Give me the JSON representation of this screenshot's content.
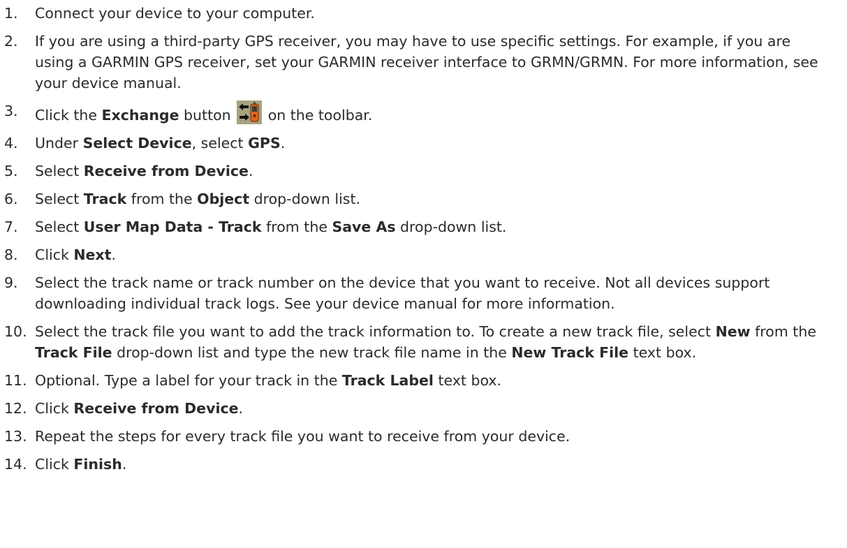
{
  "steps": [
    {
      "num": "1.",
      "parts": [
        {
          "t": "Connect your device to your computer."
        }
      ]
    },
    {
      "num": "2.",
      "parts": [
        {
          "t": "If you are using a third-party GPS receiver, you may have to use specific settings. For example, if you are using a GARMIN GPS receiver, set your GARMIN receiver interface to GRMN/GRMN. For more information, see your device manual."
        }
      ]
    },
    {
      "num": "3.",
      "parts": [
        {
          "t": "Click the "
        },
        {
          "t": "Exchange",
          "b": true
        },
        {
          "t": " button "
        },
        {
          "icon": "exchange-icon"
        },
        {
          "t": " on the toolbar."
        }
      ]
    },
    {
      "num": "4.",
      "parts": [
        {
          "t": "Under "
        },
        {
          "t": "Select Device",
          "b": true
        },
        {
          "t": ", select "
        },
        {
          "t": "GPS",
          "b": true
        },
        {
          "t": "."
        }
      ]
    },
    {
      "num": "5.",
      "parts": [
        {
          "t": "Select "
        },
        {
          "t": "Receive from Device",
          "b": true
        },
        {
          "t": "."
        }
      ]
    },
    {
      "num": "6.",
      "parts": [
        {
          "t": "Select "
        },
        {
          "t": "Track",
          "b": true
        },
        {
          "t": " from the "
        },
        {
          "t": "Object",
          "b": true
        },
        {
          "t": " drop-down list."
        }
      ]
    },
    {
      "num": "7.",
      "parts": [
        {
          "t": "Select "
        },
        {
          "t": "User Map Data - Track",
          "b": true
        },
        {
          "t": " from the "
        },
        {
          "t": "Save As",
          "b": true
        },
        {
          "t": " drop-down list."
        }
      ]
    },
    {
      "num": "8.",
      "parts": [
        {
          "t": "Click "
        },
        {
          "t": "Next",
          "b": true
        },
        {
          "t": "."
        }
      ]
    },
    {
      "num": "9.",
      "parts": [
        {
          "t": "Select the track name or track number on the device that you want to receive. Not all devices support downloading individual track logs. See your device manual for more information."
        }
      ]
    },
    {
      "num": "10.",
      "parts": [
        {
          "t": "Select the track file you want to add the track information to. To create a new track file, select "
        },
        {
          "t": "New",
          "b": true
        },
        {
          "t": " from the "
        },
        {
          "t": "Track File",
          "b": true
        },
        {
          "t": " drop-down list and type the new track file name in the "
        },
        {
          "t": "New Track File",
          "b": true
        },
        {
          "t": " text box."
        }
      ]
    },
    {
      "num": "11.",
      "parts": [
        {
          "t": "Optional. Type a label for your track in the "
        },
        {
          "t": "Track Label",
          "b": true
        },
        {
          "t": " text box."
        }
      ]
    },
    {
      "num": "12.",
      "parts": [
        {
          "t": "Click "
        },
        {
          "t": "Receive from Device",
          "b": true
        },
        {
          "t": "."
        }
      ]
    },
    {
      "num": "13.",
      "parts": [
        {
          "t": "Repeat the steps for every track file you want to receive from your device."
        }
      ]
    },
    {
      "num": "14.",
      "parts": [
        {
          "t": "Click "
        },
        {
          "t": "Finish",
          "b": true
        },
        {
          "t": "."
        }
      ]
    }
  ],
  "icons": {
    "exchange-icon": {
      "bg": "#a8a27e",
      "arrow": "#111111",
      "device": "#e8641a"
    }
  }
}
